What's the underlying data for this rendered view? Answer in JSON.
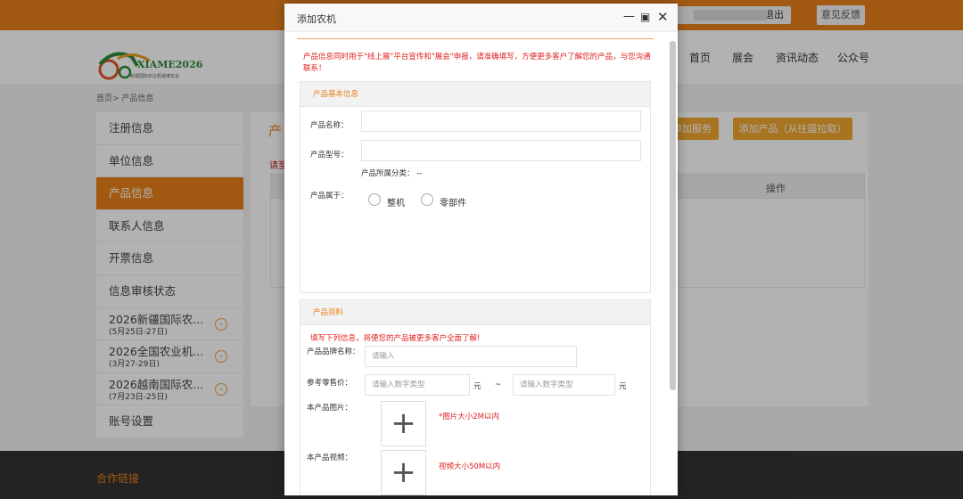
{
  "topbar": {
    "logout_label": "退出",
    "feedback_label": "意见反馈"
  },
  "logo": {
    "brand": "XIAME2026",
    "tagline": "新疆国际农业机械博览会"
  },
  "nav": {
    "items": [
      "首页",
      "展会",
      "资讯动态",
      "公众号"
    ]
  },
  "breadcrumb": "首页> 产品信息",
  "sidebar": {
    "items": [
      "注册信息",
      "单位信息",
      "产品信息",
      "联系人信息",
      "开票信息",
      "信息审核状态"
    ],
    "expos": [
      {
        "label": "2026新疆国际农...",
        "date": "(5月25日-27日)"
      },
      {
        "label": "2026全国农业机...",
        "date": "(3月27-29日)"
      },
      {
        "label": "2026越南国际农...",
        "date": "(7月23日-25日)"
      }
    ],
    "account": "账号设置"
  },
  "content": {
    "title": "产",
    "red": "请至",
    "btn_service": "添加服务",
    "btn_add": "添加产品（从往届拉取）",
    "table_op": "操作"
  },
  "footer": {
    "links": "合作链接"
  },
  "modal": {
    "title": "添加农机",
    "notice": "产品信息同时用于\"线上展\"平台宣传和\"展会\"申报，请准确填写，方便更多客户了解您的产品，与您沟通联系！",
    "basic": {
      "header": "产品基本信息",
      "name_label": "产品名称：",
      "model_label": "产品型号：",
      "category_label": "产品所属分类：",
      "category_value": "--",
      "belongs_label": "产品属于：",
      "opt_whole": "整机",
      "opt_parts": "零部件"
    },
    "material": {
      "header": "产品资料",
      "hint": "填写下列信息，将便您的产品被更多客户全面了解!",
      "brand_label": "产品品牌名称：",
      "brand_placeholder": "请输入",
      "price_label": "参考零售价：",
      "price_placeholder": "请输入数字类型",
      "unit": "元",
      "tilde": "~",
      "image_label": "本产品图片：",
      "image_hint": "*图片大小2M以内",
      "video_label": "本产品视频：",
      "video_hint": "视频大小50M以内"
    }
  },
  "colors": {
    "accent": "#e8821c",
    "button": "#f0a630",
    "notice_red": "#e02020"
  }
}
